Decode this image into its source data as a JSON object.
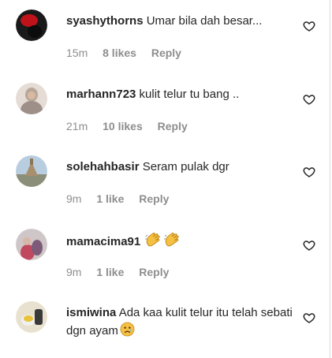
{
  "comments": [
    {
      "username": "syashythorns",
      "text": "Umar bila dah besar...",
      "time": "15m",
      "likes": "8 likes",
      "reply": "Reply"
    },
    {
      "username": "marhann723",
      "text": "kulit telur tu bang ..",
      "time": "21m",
      "likes": "10 likes",
      "reply": "Reply"
    },
    {
      "username": "solehahbasir",
      "text": "Seram pulak dgr",
      "time": "9m",
      "likes": "1 like",
      "reply": "Reply"
    },
    {
      "username": "mamacima91",
      "text": "",
      "time": "9m",
      "likes": "1 like",
      "reply": "Reply",
      "emojis": [
        "clapping-hands",
        "clapping-hands"
      ]
    },
    {
      "username": "ismiwina",
      "text": "Ada kaa kulit telur itu telah sebati dgn ayam",
      "emojis": [
        "sad-face"
      ]
    }
  ],
  "icons": {
    "heart": "heart-outline-icon"
  },
  "colors": {
    "text": "#262626",
    "secondary": "#8e8e8e",
    "border": "#dbdbdb"
  }
}
